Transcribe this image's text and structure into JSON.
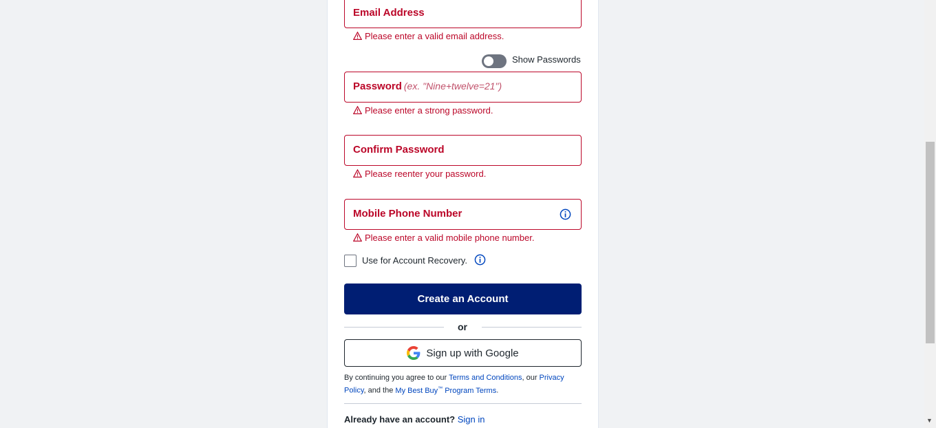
{
  "form": {
    "email": {
      "label": "Email Address",
      "error": "Please enter a valid email address."
    },
    "show_passwords": {
      "label": "Show Passwords",
      "checked": false
    },
    "password": {
      "label": "Password",
      "hint": "(ex. \"Nine+twelve=21\")",
      "error": "Please enter a strong password."
    },
    "confirm_password": {
      "label": "Confirm Password",
      "error": "Please reenter your password."
    },
    "mobile_phone": {
      "label": "Mobile Phone Number",
      "error": "Please enter a valid mobile phone number."
    },
    "account_recovery": {
      "label": "Use for Account Recovery.",
      "checked": false
    },
    "create_account_label": "Create an Account",
    "or_label": "or",
    "google_label": "Sign up with Google"
  },
  "legal": {
    "prefix": "By continuing you agree to our ",
    "terms": "Terms and Conditions",
    "mid1": ", our ",
    "privacy": "Privacy Policy",
    "mid2": ", and the ",
    "mybestbuy": "My Best Buy",
    "tm": "™",
    "program": " Program Terms",
    "suffix": "."
  },
  "footer": {
    "already": "Already have an account?",
    "signin": "Sign in"
  },
  "colors": {
    "error": "#bb0628",
    "primary": "#001e73",
    "link": "#0046be"
  },
  "icons": [
    "warning-icon",
    "info-icon",
    "google-icon",
    "scroll-down-arrow-icon"
  ]
}
